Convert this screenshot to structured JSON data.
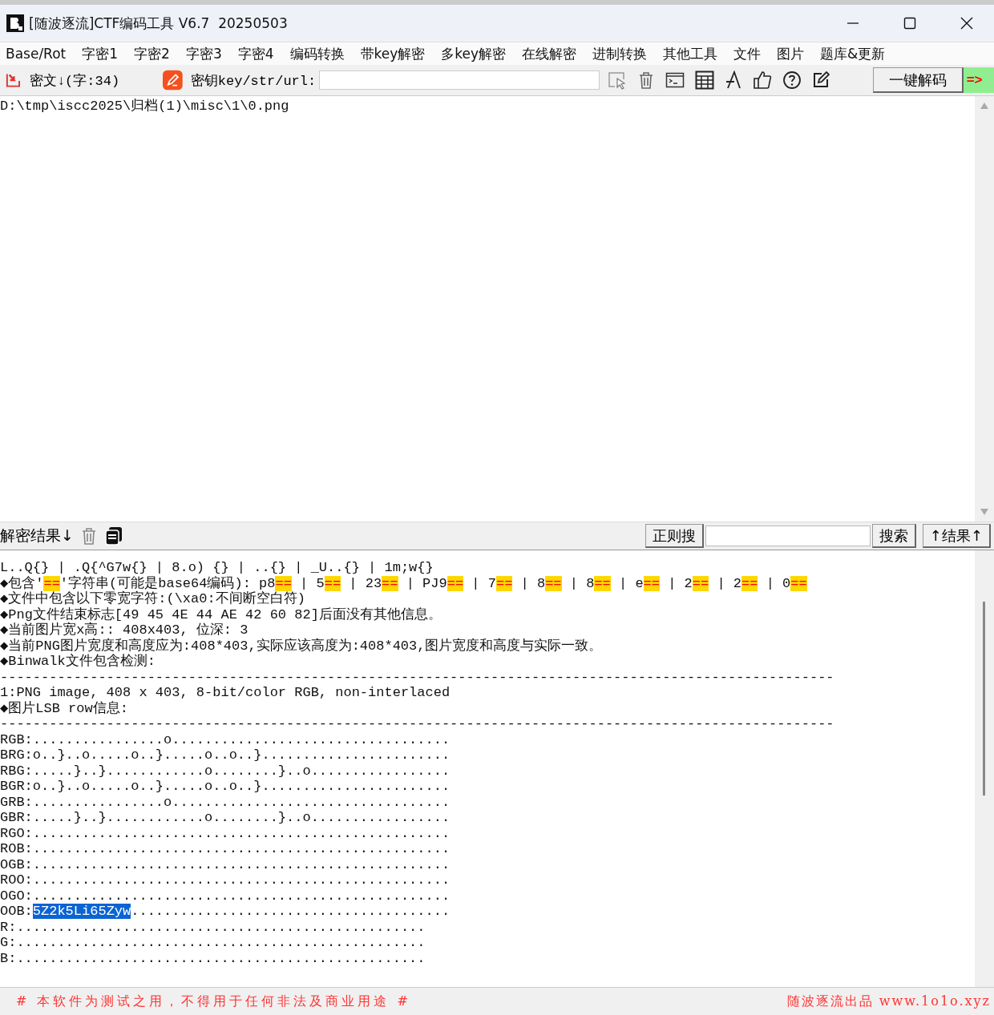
{
  "window": {
    "title": "[随波逐流]CTF编码工具 V6.7  20250503"
  },
  "menu": [
    "Base/Rot",
    "字密1",
    "字密2",
    "字密3",
    "字密4",
    "编码转换",
    "带key解密",
    "多key解密",
    "在线解密",
    "进制转换",
    "其他工具",
    "文件",
    "图片",
    "题库&更新"
  ],
  "toolbar": {
    "cipher_label": "密文↓(字:34)",
    "key_label": "密钥key/str/url:",
    "decode_button": "一键解码",
    "arrow_button": "=>"
  },
  "input_text": "D:\\tmp\\iscc2025\\归档(1)\\misc\\1\\0.png",
  "results_bar": {
    "label": "解密结果↓",
    "regex_button": "正则搜",
    "search_button": "搜索",
    "up_button": "↑结果↑"
  },
  "output_lines": [
    {
      "segments": [
        {
          "kind": "plain",
          "text": "L..Q{} | .Q{^G7w{} | 8.o) {} | ..{} | _U..{} | 1m;w{}"
        }
      ]
    },
    {
      "segments": [
        {
          "kind": "plain",
          "text": "◆包含'"
        },
        {
          "kind": "marked",
          "text": "=="
        },
        {
          "kind": "plain",
          "text": "'字符串(可能是base64编码): p8"
        },
        {
          "kind": "marked",
          "text": "=="
        },
        {
          "kind": "plain",
          "text": " | 5"
        },
        {
          "kind": "marked",
          "text": "=="
        },
        {
          "kind": "plain",
          "text": " | 23"
        },
        {
          "kind": "marked",
          "text": "=="
        },
        {
          "kind": "plain",
          "text": " | PJ9"
        },
        {
          "kind": "marked",
          "text": "=="
        },
        {
          "kind": "plain",
          "text": " | 7"
        },
        {
          "kind": "marked",
          "text": "=="
        },
        {
          "kind": "plain",
          "text": " | 8"
        },
        {
          "kind": "marked",
          "text": "=="
        },
        {
          "kind": "plain",
          "text": " | 8"
        },
        {
          "kind": "marked",
          "text": "=="
        },
        {
          "kind": "plain",
          "text": " | e"
        },
        {
          "kind": "marked",
          "text": "=="
        },
        {
          "kind": "plain",
          "text": " | 2"
        },
        {
          "kind": "marked",
          "text": "=="
        },
        {
          "kind": "plain",
          "text": " | 2"
        },
        {
          "kind": "marked",
          "text": "=="
        },
        {
          "kind": "plain",
          "text": " | 0"
        },
        {
          "kind": "marked",
          "text": "=="
        }
      ]
    },
    {
      "segments": [
        {
          "kind": "plain",
          "text": "◆文件中包含以下零宽字符:(\\xa0:不间断空白符)"
        }
      ]
    },
    {
      "segments": [
        {
          "kind": "plain",
          "text": "◆Png文件结束标志[49 45 4E 44 AE 42 60 82]后面没有其他信息。"
        }
      ]
    },
    {
      "segments": [
        {
          "kind": "plain",
          "text": "◆当前图片宽x高:: 408x403, 位深: 3"
        }
      ]
    },
    {
      "segments": [
        {
          "kind": "plain",
          "text": "◆当前PNG图片宽度和高度应为:408*403,实际应该高度为:408*403,图片宽度和高度与实际一致。"
        }
      ]
    },
    {
      "segments": [
        {
          "kind": "plain",
          "text": "◆Binwalk文件包含检测:"
        }
      ]
    },
    {
      "segments": [
        {
          "kind": "plain",
          "text": "------------------------------------------------------------------------------------------------------"
        }
      ]
    },
    {
      "segments": [
        {
          "kind": "plain",
          "text": "1:PNG image, 408 x 403, 8-bit/color RGB, non-interlaced"
        }
      ]
    },
    {
      "segments": [
        {
          "kind": "plain",
          "text": "◆图片LSB row信息:"
        }
      ]
    },
    {
      "segments": [
        {
          "kind": "plain",
          "text": "------------------------------------------------------------------------------------------------------"
        }
      ]
    },
    {
      "segments": [
        {
          "kind": "plain",
          "text": "RGB:................o.................................."
        }
      ]
    },
    {
      "segments": [
        {
          "kind": "plain",
          "text": "BRG:o..}..o.....o..}.....o..o..}......................."
        }
      ]
    },
    {
      "segments": [
        {
          "kind": "plain",
          "text": "RBG:.....}..}............o........}..o................."
        }
      ]
    },
    {
      "segments": [
        {
          "kind": "plain",
          "text": "BGR:o..}..o.....o..}.....o..o..}......................."
        }
      ]
    },
    {
      "segments": [
        {
          "kind": "plain",
          "text": "GRB:................o.................................."
        }
      ]
    },
    {
      "segments": [
        {
          "kind": "plain",
          "text": "GBR:.....}..}............o........}..o................."
        }
      ]
    },
    {
      "segments": [
        {
          "kind": "plain",
          "text": "RGO:..................................................."
        }
      ]
    },
    {
      "segments": [
        {
          "kind": "plain",
          "text": "ROB:..................................................."
        }
      ]
    },
    {
      "segments": [
        {
          "kind": "plain",
          "text": "OGB:..................................................."
        }
      ]
    },
    {
      "segments": [
        {
          "kind": "plain",
          "text": "ROO:..................................................."
        }
      ]
    },
    {
      "segments": [
        {
          "kind": "plain",
          "text": "OGO:..................................................."
        }
      ]
    },
    {
      "segments": [
        {
          "kind": "plain",
          "text": "OOB:"
        },
        {
          "kind": "selected",
          "text": "5Z2k5Li65Zyw"
        },
        {
          "kind": "plain",
          "text": "......................................."
        }
      ]
    },
    {
      "segments": [
        {
          "kind": "plain",
          "text": "R:.................................................."
        }
      ]
    },
    {
      "segments": [
        {
          "kind": "plain",
          "text": "G:.................................................."
        }
      ]
    },
    {
      "segments": [
        {
          "kind": "plain",
          "text": "B:.................................................."
        }
      ]
    }
  ],
  "status_bar": {
    "notice": "# 本软件为测试之用，不得用于任何非法及商业用途 #",
    "credit": "随波逐流出品 www.1o1o.xyz"
  }
}
